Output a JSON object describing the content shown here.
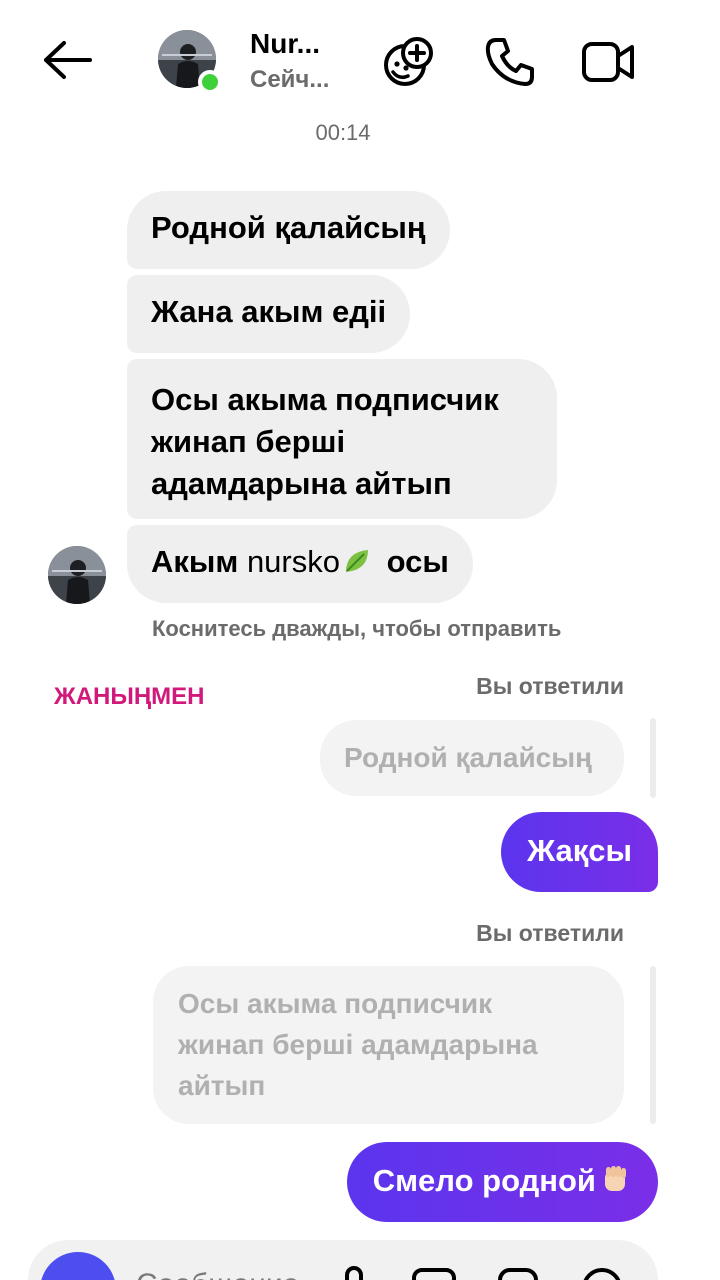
{
  "header": {
    "contact_name": "Nur...",
    "contact_status": "Сейч...",
    "icons": [
      "back-arrow-icon",
      "effects-face-plus-icon",
      "phone-icon",
      "video-camera-icon"
    ]
  },
  "timestamp": "00:14",
  "incoming": [
    {
      "text": "Родной қалайсың"
    },
    {
      "text": "Жана акым едіі"
    },
    {
      "lines": [
        "Осы акыма подписчик",
        "жинап берші",
        "адамдарына айтып"
      ]
    },
    {
      "prefix": "Акым",
      "handle": "nursko",
      "suffix": "осы",
      "emoji": "leaf-emoji"
    }
  ],
  "hint": "Коснитесь дважды, чтобы отправить",
  "watermark": "ЖАНЫҢМЕН",
  "replies": [
    {
      "label": "Вы ответили",
      "quote": "Родной қалайсың",
      "message": "Жақсы"
    },
    {
      "label": "Вы ответили",
      "quote_lines": [
        "Осы акыма подписчик",
        "жинап берші адамдарына",
        "айтып"
      ],
      "message": "Смело родной",
      "emoji": "raised-fist-emoji"
    }
  ],
  "composer": {
    "placeholder": "Сообщение...",
    "icons": [
      "camera-icon",
      "microphone-icon",
      "gallery-icon",
      "sticker-icon",
      "plus-icon"
    ]
  },
  "colors": {
    "outgoing_start": "#5b35ee",
    "outgoing_end": "#7b2ee8",
    "incoming_bg": "#efefef",
    "online": "#3ed13a",
    "watermark": "#d0197a"
  }
}
